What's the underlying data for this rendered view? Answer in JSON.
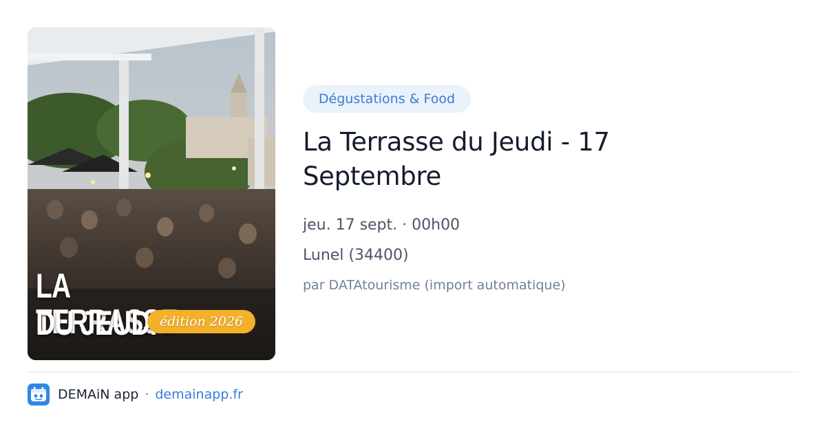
{
  "event": {
    "category": "Dégustations & Food",
    "title_line1": "La Terrasse du Jeudi - 17",
    "title_line2": "Septembre",
    "date": "jeu. 17 sept. · 00h00",
    "location": "Lunel (34400)",
    "source": "par DATAtourisme (import automatique)"
  },
  "poster": {
    "title_line1": "LA TERRASSE",
    "title_line2": "DU JEUDI",
    "edition": "édition 2026"
  },
  "footer": {
    "app_name": "DEMAiN app",
    "separator": "·",
    "url": "demainapp.fr"
  },
  "colors": {
    "accent": "#3a7bd5",
    "pill_bg": "#eaf2fb",
    "badge": "#f3b12a",
    "logo": "#2f86e8"
  },
  "icons": {
    "app_logo": "demain-app-logo-icon"
  }
}
